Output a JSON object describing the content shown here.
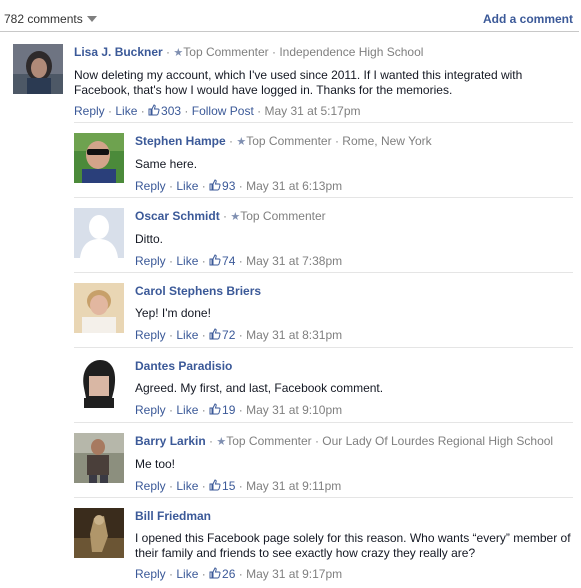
{
  "header": {
    "comment_count": "782 comments",
    "add_comment": "Add a comment"
  },
  "labels": {
    "reply": "Reply",
    "like": "Like",
    "follow_post": "Follow Post",
    "dot": " · "
  },
  "colors": {
    "link": "#3b5998",
    "meta": "#7f7f7f",
    "separator": "#e5e5e5"
  },
  "comments": [
    {
      "name": "Lisa J. Buckner",
      "badge": "Top Commenter",
      "affiliation": "Independence High School",
      "text": "Now deleting my account, which I've used since 2011. If I wanted this integrated with Facebook, that's how I would have logged in. Thanks for the memories.",
      "likes": "303",
      "follow": true,
      "timestamp": "May 31 at 5:17pm",
      "avatar": "woman-dark-icon"
    },
    {
      "name": "Stephen Hampe",
      "badge": "Top Commenter",
      "affiliation": "Rome, New York",
      "text": "Same here.",
      "likes": "93",
      "timestamp": "May 31 at 6:13pm",
      "avatar": "man-sunglasses-icon"
    },
    {
      "name": "Oscar Schmidt",
      "badge": "Top Commenter",
      "affiliation": "",
      "text": "Ditto.",
      "likes": "74",
      "timestamp": "May 31 at 7:38pm",
      "avatar": "default-silhouette-icon"
    },
    {
      "name": "Carol Stephens Briers",
      "badge": "",
      "affiliation": "",
      "text": "Yep! I'm done!",
      "likes": "72",
      "timestamp": "May 31 at 8:31pm",
      "avatar": "older-woman-icon"
    },
    {
      "name": "Dantes Paradisio",
      "badge": "",
      "affiliation": "",
      "text": "Agreed. My first, and last, Facebook comment.",
      "likes": "19",
      "timestamp": "May 31 at 9:10pm",
      "avatar": "cartoon-hair-icon"
    },
    {
      "name": "Barry Larkin",
      "badge": "Top Commenter",
      "affiliation": "Our Lady Of Lourdes Regional High School",
      "text": "Me too!",
      "likes": "15",
      "timestamp": "May 31 at 9:11pm",
      "avatar": "man-outdoor-icon"
    },
    {
      "name": "Bill Friedman",
      "badge": "",
      "affiliation": "",
      "text": "I opened this Facebook page solely for this reason. Who wants “every” member of their family and friends to see exactly how crazy they really are?",
      "likes": "26",
      "timestamp": "May 31 at 9:17pm",
      "avatar": "art-figure-icon"
    }
  ]
}
